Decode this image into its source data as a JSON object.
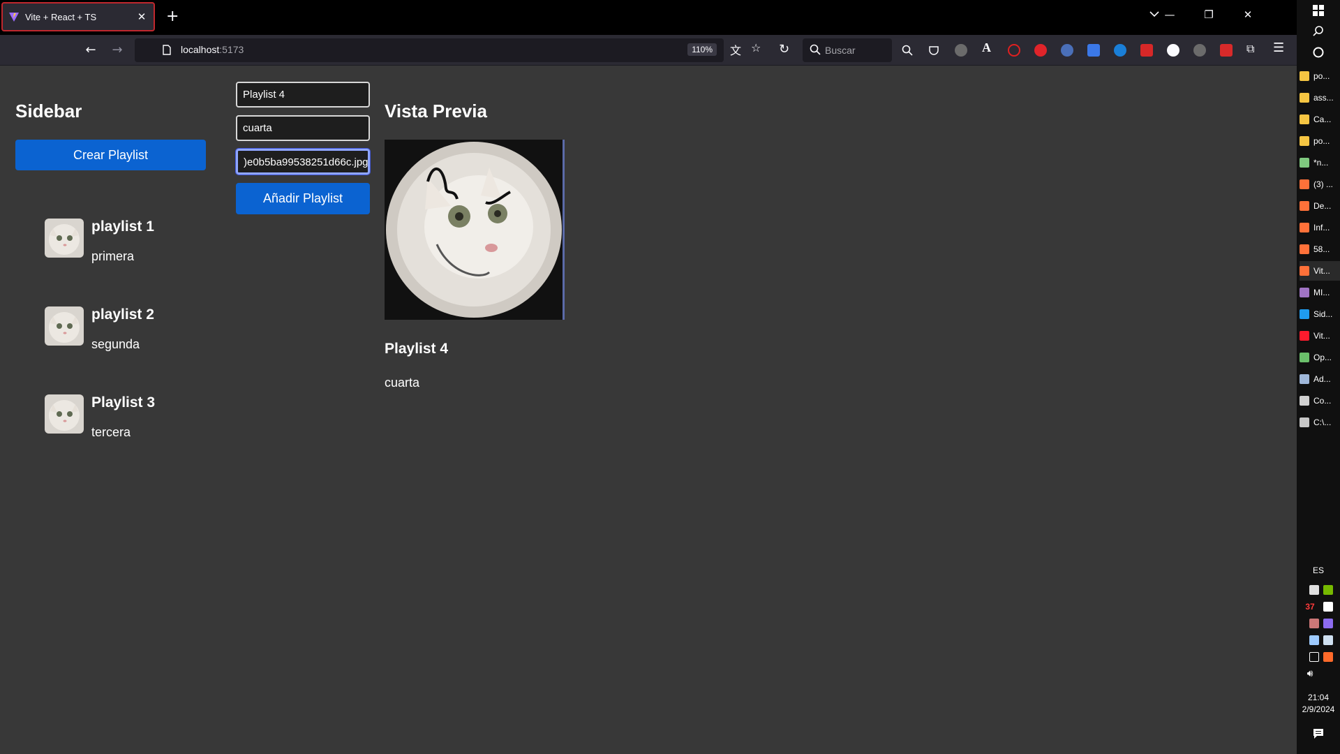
{
  "browser": {
    "tab_title": "Vite + React + TS",
    "url_host": "localhost",
    "url_port": ":5173",
    "zoom": "110%",
    "search_placeholder": "Buscar"
  },
  "app": {
    "sidebar_title": "Sidebar",
    "create_button": "Crear Playlist",
    "playlists": [
      {
        "name": "playlist 1",
        "description": "primera"
      },
      {
        "name": "playlist 2",
        "description": "segunda"
      },
      {
        "name": "Playlist 3",
        "description": "tercera"
      }
    ],
    "form": {
      "name_value": "Playlist 4",
      "description_value": "cuarta",
      "image_value": ")e0b5ba99538251d66c.jpg",
      "add_button": "Añadir Playlist"
    },
    "preview": {
      "title": "Vista Previa",
      "name": "Playlist 4",
      "description": "cuarta"
    }
  },
  "taskbar": {
    "windows": [
      {
        "label": "po...",
        "icon": "folder-icon",
        "color": "#f5c542"
      },
      {
        "label": "ass...",
        "icon": "folder-icon",
        "color": "#f5c542"
      },
      {
        "label": "Ca...",
        "icon": "folder-icon",
        "color": "#f5c542"
      },
      {
        "label": "po...",
        "icon": "folder-icon",
        "color": "#f5c542"
      },
      {
        "label": "*n...",
        "icon": "notepad-icon",
        "color": "#7fc97f"
      },
      {
        "label": "(3) ...",
        "icon": "firefox-icon",
        "color": "#ff7139"
      },
      {
        "label": "De...",
        "icon": "firefox-icon",
        "color": "#ff7139"
      },
      {
        "label": "Inf...",
        "icon": "firefox-icon",
        "color": "#ff7139"
      },
      {
        "label": "58...",
        "icon": "firefox-icon",
        "color": "#ff7139"
      },
      {
        "label": "Vit...",
        "icon": "firefox-icon",
        "color": "#ff7139"
      },
      {
        "label": "MI...",
        "icon": "visual-studio-icon",
        "color": "#a074c4"
      },
      {
        "label": "Sid...",
        "icon": "vscode-icon",
        "color": "#1f9cf0"
      },
      {
        "label": "Vit...",
        "icon": "opera-icon",
        "color": "#ff1b2d"
      },
      {
        "label": "Op...",
        "icon": "app-icon",
        "color": "#6bbf6b"
      },
      {
        "label": "Ad...",
        "icon": "admin-icon",
        "color": "#9fb7d9"
      },
      {
        "label": "Co...",
        "icon": "gear-icon",
        "color": "#d0d0d0"
      },
      {
        "label": "C:\\...",
        "icon": "terminal-icon",
        "color": "#c8c8c8"
      }
    ],
    "language": "ES",
    "notification_count": "37",
    "time": "21:04",
    "date": "2/9/2024"
  }
}
